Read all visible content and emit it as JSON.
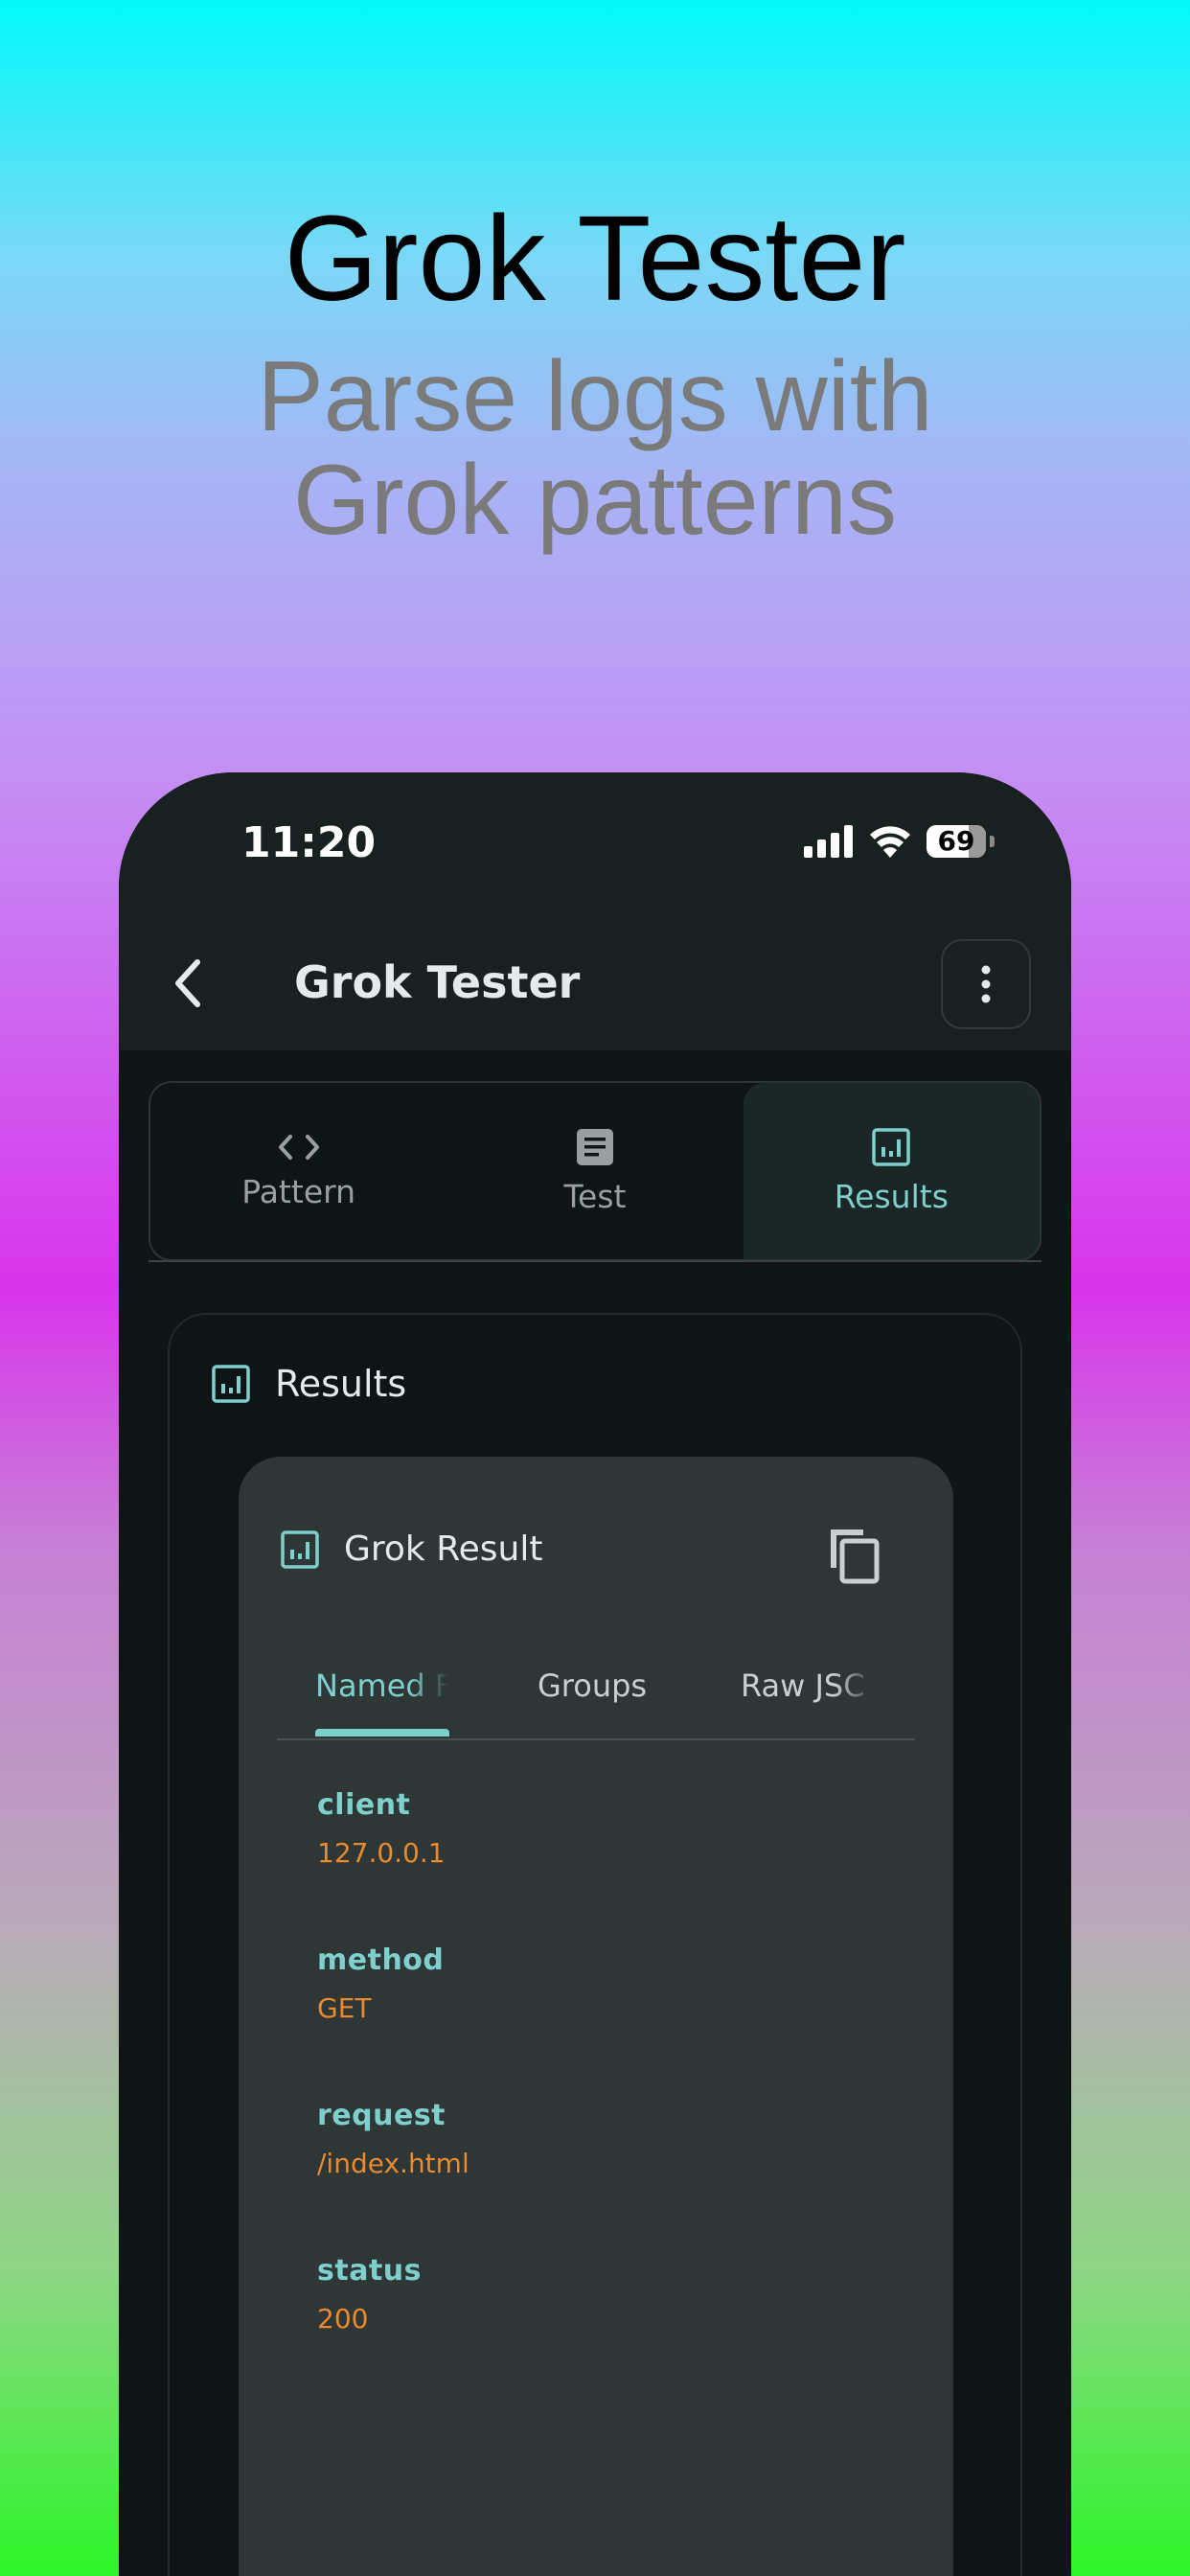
{
  "promo": {
    "headline": "Grok Tester",
    "subhead_line1": "Parse logs with",
    "subhead_line2": "Grok patterns"
  },
  "status_bar": {
    "time": "11:20",
    "battery": "69"
  },
  "app_bar": {
    "title": "Grok Tester"
  },
  "tabs": [
    {
      "label": "Pattern",
      "icon": "code-icon",
      "active": false
    },
    {
      "label": "Test",
      "icon": "document-icon",
      "active": false
    },
    {
      "label": "Results",
      "icon": "chart-icon",
      "active": true
    }
  ],
  "results_card": {
    "title": "Results"
  },
  "grok_result": {
    "title": "Grok Result",
    "tabs": [
      "Named F",
      "Groups",
      "Raw JSC"
    ],
    "fields": [
      {
        "name": "client",
        "value": "127.0.0.1"
      },
      {
        "name": "method",
        "value": "GET"
      },
      {
        "name": "request",
        "value": "/index.html"
      },
      {
        "name": "status",
        "value": "200"
      }
    ]
  },
  "colors": {
    "accent": "#7fd0cc",
    "value": "#e98a2e",
    "background": "#0f1414",
    "surface": "#2e3636"
  }
}
